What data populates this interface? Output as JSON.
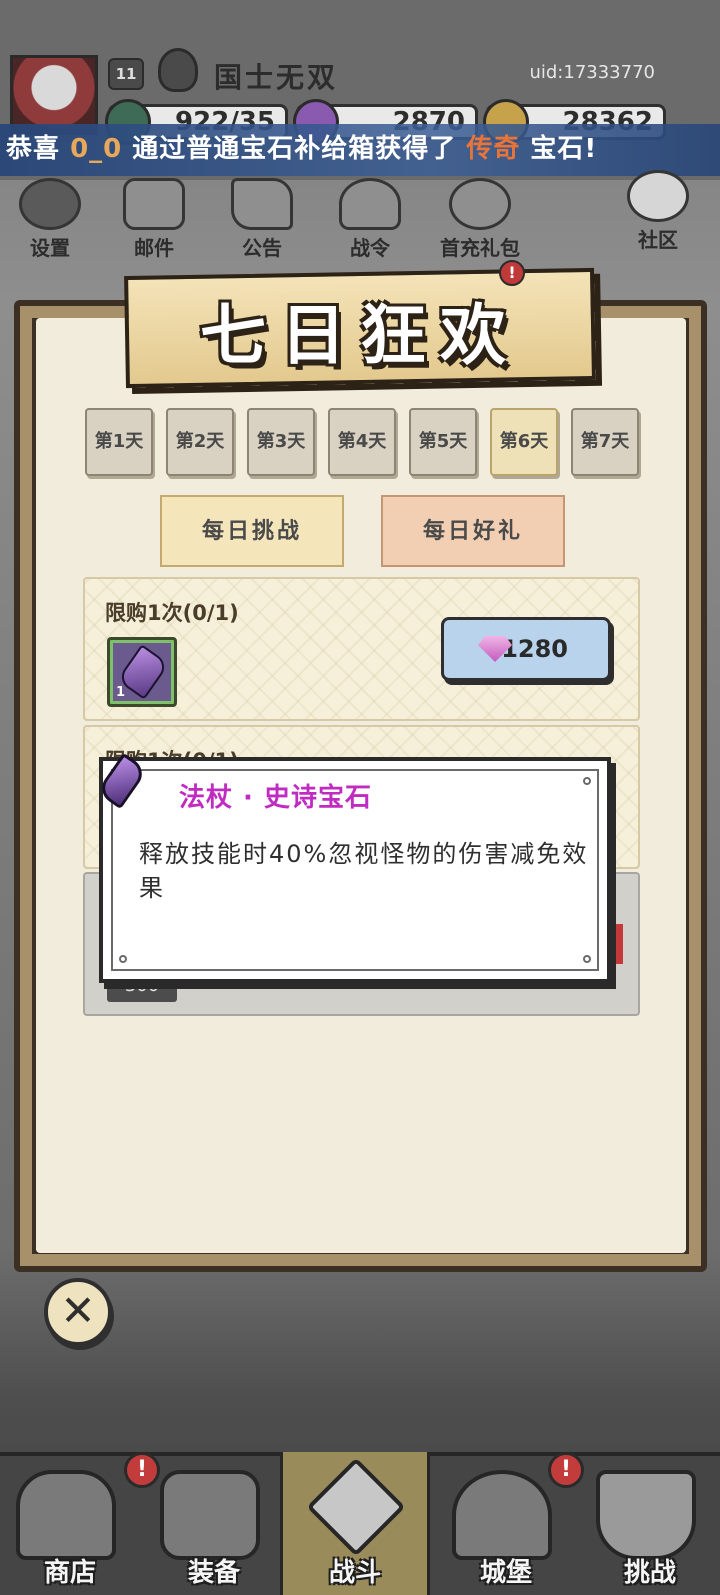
{
  "header": {
    "level": "11",
    "player_name": "国士无双",
    "uid": "uid:17333770",
    "resources": [
      "922/35",
      "2870",
      "28362"
    ]
  },
  "marquee": {
    "prefix": "恭喜 ",
    "player": "0_0",
    "middle": " 通过普通宝石补给箱获得了 ",
    "rarity": "传奇",
    "suffix": " 宝石!"
  },
  "top_nav": [
    "设置",
    "邮件",
    "公告",
    "战令",
    "首充礼包",
    "社区"
  ],
  "panel": {
    "title": "七日狂欢",
    "badge": "!",
    "days": [
      "第1天",
      "第2天",
      "第3天",
      "第4天",
      "第5天",
      "第6天",
      "第7天"
    ],
    "active_day_index": 5,
    "sub_tabs": [
      "每日挑战",
      "每日好礼"
    ],
    "cards": [
      {
        "limit": "限购1次(0/1)",
        "item_count": "1",
        "price": "1280"
      },
      {
        "limit": "限购1次(0/1)"
      },
      {
        "price": "300"
      }
    ]
  },
  "tooltip": {
    "title": "法杖 · 史诗宝石",
    "description": "释放技能时40%忽视怪物的伤害减免效果"
  },
  "bottom_nav": [
    "商店",
    "装备",
    "战斗",
    "城堡",
    "挑战"
  ],
  "alerts": [
    "!",
    "!"
  ],
  "colors": {
    "tooltip_title": "#c02bc2",
    "marquee_player": "#e8a85a",
    "marquee_rarity": "#e8743a",
    "price_button": "#b9d3ec"
  }
}
